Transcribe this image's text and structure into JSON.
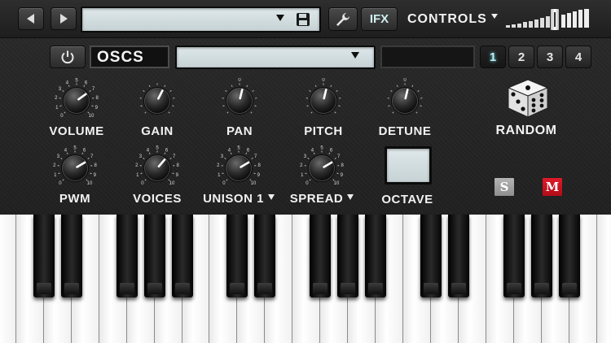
{
  "topbar": {
    "ifx_label": "IFX",
    "controls_label": "CONTROLS",
    "volume_level": 0.6
  },
  "osc": {
    "name": "OSCS",
    "page_buttons": [
      "1",
      "2",
      "3",
      "4"
    ],
    "active_page": 0
  },
  "knobs_row1": [
    {
      "label": "VOLUME",
      "value": 0.7,
      "scale": "numbers"
    },
    {
      "label": "GAIN",
      "value": 0.6,
      "scale": "none"
    },
    {
      "label": "PAN",
      "value": 0.55,
      "scale": "zero"
    },
    {
      "label": "PITCH",
      "value": 0.55,
      "scale": "zero"
    },
    {
      "label": "DETUNE",
      "value": 0.55,
      "scale": "zero"
    }
  ],
  "knobs_row2": [
    {
      "label": "PWM",
      "value": 0.72,
      "scale": "numbers"
    },
    {
      "label": "VOICES",
      "value": 0.65,
      "scale": "numbers"
    },
    {
      "label": "UNISON 1",
      "value": 0.72,
      "scale": "numbers"
    },
    {
      "label": "SPREAD",
      "value": 0.72,
      "scale": "numbers"
    }
  ],
  "octave_label": "OCTAVE",
  "random_label": "RANDOM",
  "solo_label": "S",
  "mute_label": "M",
  "scale_numbers": [
    "0",
    "1",
    "2",
    "3",
    "4",
    "5",
    "6",
    "7",
    "8",
    "9",
    "10"
  ],
  "zero_mark": "0",
  "colors": {
    "mute": "#c8101f",
    "solo": "#9a9a9a",
    "accent": "#b5f0ef"
  }
}
